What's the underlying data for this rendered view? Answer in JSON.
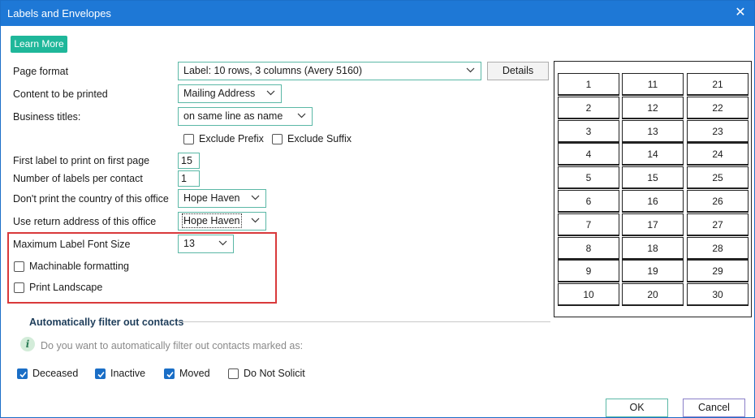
{
  "window": {
    "title": "Labels and Envelopes",
    "close_glyph": "✕"
  },
  "learn_more": "Learn More",
  "form": {
    "page_format": {
      "label": "Page format",
      "value": "Label: 10 rows, 3 columns (Avery 5160)",
      "details_button": "Details"
    },
    "content": {
      "label": "Content to be printed",
      "value": "Mailing Address"
    },
    "business_titles": {
      "label": "Business titles:",
      "value": "on same line as name"
    },
    "exclude_prefix": {
      "label": "Exclude Prefix",
      "checked": false
    },
    "exclude_suffix": {
      "label": "Exclude Suffix",
      "checked": false
    },
    "first_label": {
      "label": "First label to print on first page",
      "value": "15"
    },
    "labels_per_contact": {
      "label": "Number of labels per contact",
      "value": "1"
    },
    "no_country": {
      "label": "Don't print the country of this office",
      "value": "Hope Haven"
    },
    "return_address": {
      "label": "Use return address of this office",
      "value": "Hope Haven"
    },
    "max_font": {
      "label": "Maximum Label Font Size",
      "value": "13"
    },
    "machinable": {
      "label": "Machinable formatting",
      "checked": false
    },
    "landscape": {
      "label": "Print Landscape",
      "checked": false
    }
  },
  "label_grid": {
    "columns": [
      [
        "1",
        "2",
        "3",
        "4",
        "5",
        "6",
        "7",
        "8",
        "9",
        "10"
      ],
      [
        "11",
        "12",
        "13",
        "14",
        "15",
        "16",
        "17",
        "18",
        "19",
        "20"
      ],
      [
        "21",
        "22",
        "23",
        "24",
        "25",
        "26",
        "27",
        "28",
        "29",
        "30"
      ]
    ]
  },
  "filter": {
    "title": "Automatically filter out contacts",
    "info_glyph": "i",
    "question": "Do you want to automatically filter out contacts marked as:",
    "options": [
      {
        "label": "Deceased",
        "checked": true
      },
      {
        "label": "Inactive",
        "checked": true
      },
      {
        "label": "Moved",
        "checked": true
      },
      {
        "label": "Do Not Solicit",
        "checked": false
      }
    ]
  },
  "footer": {
    "ok": "OK",
    "cancel": "Cancel"
  },
  "colors": {
    "titlebar": "#1e78d6",
    "accent": "#1fb79a",
    "checkbox_on": "#1a6ec6",
    "highlight": "#d9393b"
  }
}
